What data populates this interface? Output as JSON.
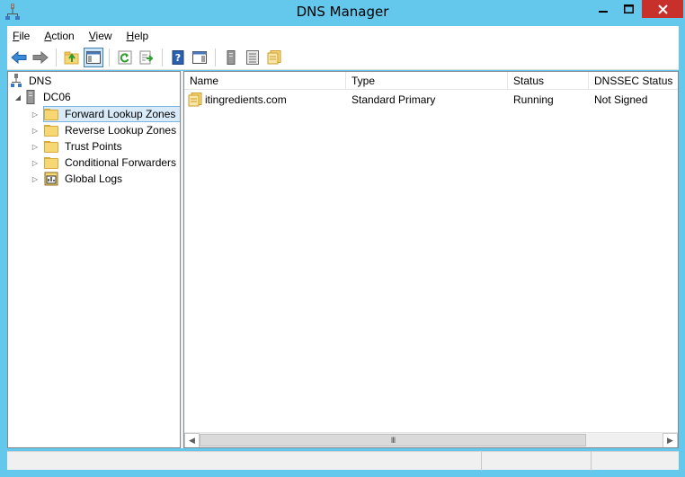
{
  "window": {
    "title": "DNS Manager",
    "accent_color": "#64c8ec",
    "close_color": "#c7302b"
  },
  "menu": {
    "file": {
      "mnemonic": "F",
      "rest": "ile"
    },
    "action": {
      "mnemonic": "A",
      "rest": "ction"
    },
    "view": {
      "mnemonic": "V",
      "rest": "iew"
    },
    "help": {
      "mnemonic": "H",
      "rest": "elp"
    }
  },
  "toolbar": {
    "icons": [
      "back-arrow-icon",
      "forward-arrow-icon",
      "up-folder-icon",
      "show-hide-console-tree-icon",
      "refresh-icon",
      "export-list-icon",
      "help-icon",
      "properties-pane-icon",
      "server-icon",
      "list-icon",
      "zone-icon"
    ]
  },
  "tree": {
    "root": "DNS",
    "server": "DC06",
    "children": [
      {
        "label": "Forward Lookup Zones",
        "icon": "folder-icon",
        "selected": true
      },
      {
        "label": "Reverse Lookup Zones",
        "icon": "folder-icon",
        "selected": false
      },
      {
        "label": "Trust Points",
        "icon": "folder-icon",
        "selected": false
      },
      {
        "label": "Conditional Forwarders",
        "icon": "folder-icon",
        "selected": false
      },
      {
        "label": "Global Logs",
        "icon": "logs-icon",
        "selected": false
      }
    ]
  },
  "list": {
    "columns": [
      "Name",
      "Type",
      "Status",
      "DNSSEC Status"
    ],
    "rows": [
      {
        "name": "itingredients.com",
        "type": "Standard Primary",
        "status": "Running",
        "dnssec": "Not Signed"
      }
    ],
    "scroll_thumb": "III"
  }
}
